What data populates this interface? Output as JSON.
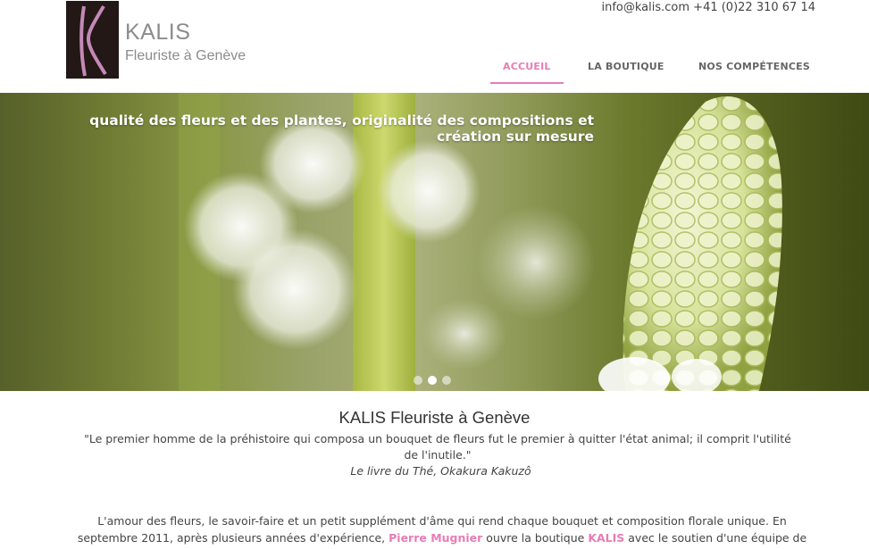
{
  "header": {
    "logo_alt": "K",
    "brand_name": "KALIS",
    "brand_subtitle": "Fleuriste à Genève",
    "contact": "info@kalis.com +41 (0)22 310 67 14"
  },
  "nav": {
    "items": [
      {
        "label": "ACCUEIL",
        "active": true
      },
      {
        "label": "LA BOUTIQUE",
        "active": false
      },
      {
        "label": "NOS COMPÉTENCES",
        "active": false
      }
    ],
    "accent_color": "#e77db6"
  },
  "hero": {
    "caption_line1": "qualité des fleurs et des plantes, originalité des compositions et",
    "caption_line2": "création sur mesure",
    "slides_count": 3,
    "active_slide": 2
  },
  "content": {
    "title": "KALIS Fleuriste à Genève",
    "quote": "\"Le premier homme de la préhistoire qui composa un bouquet de fleurs fut le premier à quitter l'état animal; il comprit l'utilité de l'inutile.\"",
    "quote_author": "Le livre du Thé, Okakura Kakuzô",
    "body_part1": "L'amour des fleurs, le savoir-faire et un petit supplément d'âme qui rend chaque bouquet et composition florale unique. En septembre 2011, après plusieurs années d'expérience, ",
    "body_name": "Pierre Mugnier",
    "body_part2": " ouvre la boutique ",
    "body_brand": "KALIS",
    "body_part3": " avec le soutien d'une équipe de fleuristes"
  }
}
